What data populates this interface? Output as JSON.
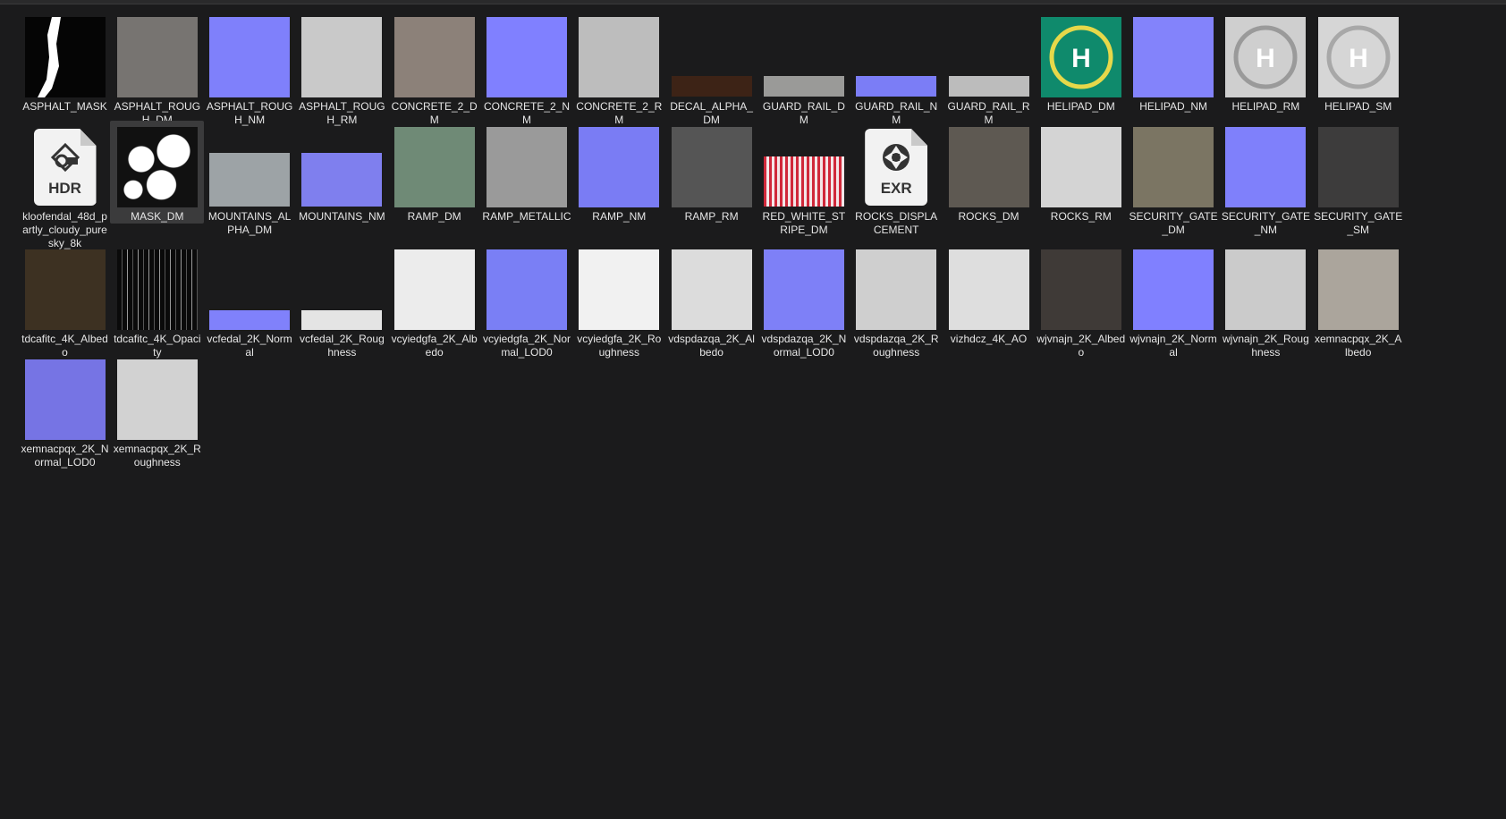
{
  "files": [
    {
      "name": "ASPHALT_MASK",
      "thumb": "mask",
      "bg": "#050505"
    },
    {
      "name": "ASPHALT_ROUGH_DM",
      "thumb": "square",
      "bg": "#777471"
    },
    {
      "name": "ASPHALT_ROUGH_NM",
      "thumb": "square",
      "bg": "#7f80fb"
    },
    {
      "name": "ASPHALT_ROUGH_RM",
      "thumb": "square",
      "bg": "#c9c9c9"
    },
    {
      "name": "CONCRETE_2_DM",
      "thumb": "square",
      "bg": "#8c8179"
    },
    {
      "name": "CONCRETE_2_NM",
      "thumb": "square",
      "bg": "#8080ff"
    },
    {
      "name": "CONCRETE_2_RM",
      "thumb": "square",
      "bg": "#bdbdbd"
    },
    {
      "name": "DECAL_ALPHA_DM",
      "thumb": "strip",
      "bg": "#3d2316"
    },
    {
      "name": "GUARD_RAIL_DM",
      "thumb": "strip",
      "bg": "#9a9a98"
    },
    {
      "name": "GUARD_RAIL_NM",
      "thumb": "strip",
      "bg": "#7b7df6"
    },
    {
      "name": "GUARD_RAIL_RM",
      "thumb": "strip",
      "bg": "#bcbcbc"
    },
    {
      "name": "HELIPAD_DM",
      "thumb": "helipad",
      "bg": "#0f8a6c",
      "ring": "#e6d84a",
      "letter": "H"
    },
    {
      "name": "HELIPAD_NM",
      "thumb": "square",
      "bg": "#8383fb"
    },
    {
      "name": "HELIPAD_RM",
      "thumb": "helipad",
      "bg": "#cfcfcf",
      "ring": "#9a9a9a",
      "letter": "H"
    },
    {
      "name": "HELIPAD_SM",
      "thumb": "helipad",
      "bg": "#d6d6d6",
      "ring": "#a8a8a8",
      "letter": "H"
    },
    {
      "name": "kloofendal_48d_partly_cloudy_puresky_8k",
      "thumb": "hdr-icon",
      "ext": "HDR"
    },
    {
      "name": "MASK_DM",
      "thumb": "mask2",
      "bg": "#111111",
      "selected": true
    },
    {
      "name": "MOUNTAINS_ALPHA_DM",
      "thumb": "half",
      "bg": "#9da3a6"
    },
    {
      "name": "MOUNTAINS_NM",
      "thumb": "half",
      "bg": "#7f7fee"
    },
    {
      "name": "RAMP_DM",
      "thumb": "square",
      "bg": "#6f8a76"
    },
    {
      "name": "RAMP_METALLIC",
      "thumb": "square",
      "bg": "#9a9a9a"
    },
    {
      "name": "RAMP_NM",
      "thumb": "square",
      "bg": "#7a7cf4"
    },
    {
      "name": "RAMP_RM",
      "thumb": "square",
      "bg": "#555555"
    },
    {
      "name": "RED_WHITE_STRIPE_DM",
      "thumb": "stripes",
      "bg": "#d0283a"
    },
    {
      "name": "ROCKS_DISPLACEMENT",
      "thumb": "exr-icon",
      "ext": "EXR"
    },
    {
      "name": "ROCKS_DM",
      "thumb": "square",
      "bg": "#5e5952"
    },
    {
      "name": "ROCKS_RM",
      "thumb": "square",
      "bg": "#d4d4d4"
    },
    {
      "name": "SECURITY_GATE_DM",
      "thumb": "square",
      "bg": "#7b7563"
    },
    {
      "name": "SECURITY_GATE_NM",
      "thumb": "square",
      "bg": "#7f80fb"
    },
    {
      "name": "SECURITY_GATE_SM",
      "thumb": "square",
      "bg": "#3d3c3c"
    },
    {
      "name": "tdcafitc_4K_Albedo",
      "thumb": "square",
      "bg": "#3d3122"
    },
    {
      "name": "tdcafitc_4K_Opacity",
      "thumb": "opacity",
      "bg": "#0a0a0a"
    },
    {
      "name": "vcfedal_2K_Normal",
      "thumb": "lowstrip",
      "bg": "#8081fb"
    },
    {
      "name": "vcfedal_2K_Roughness",
      "thumb": "lowstrip",
      "bg": "#e4e4e4"
    },
    {
      "name": "vcyiedgfa_2K_Albedo",
      "thumb": "square",
      "bg": "#ececec"
    },
    {
      "name": "vcyiedgfa_2K_Normal_LOD0",
      "thumb": "square",
      "bg": "#7a7ff5"
    },
    {
      "name": "vcyiedgfa_2K_Roughness",
      "thumb": "square",
      "bg": "#f1f1f1"
    },
    {
      "name": "vdspdazqa_2K_Albedo",
      "thumb": "square",
      "bg": "#dcdcdc"
    },
    {
      "name": "vdspdazqa_2K_Normal_LOD0",
      "thumb": "square",
      "bg": "#7e80f7"
    },
    {
      "name": "vdspdazqa_2K_Roughness",
      "thumb": "square",
      "bg": "#cfcfcf"
    },
    {
      "name": "vizhdcz_4K_AO",
      "thumb": "square",
      "bg": "#dedede"
    },
    {
      "name": "wjvnajn_2K_Albedo",
      "thumb": "square",
      "bg": "#3f3a37"
    },
    {
      "name": "wjvnajn_2K_Normal",
      "thumb": "square",
      "bg": "#8080ff"
    },
    {
      "name": "wjvnajn_2K_Roughness",
      "thumb": "square",
      "bg": "#cbcbcb"
    },
    {
      "name": "xemnacpqx_2K_Albedo",
      "thumb": "square",
      "bg": "#aba59c"
    },
    {
      "name": "xemnacpqx_2K_Normal_LOD0",
      "thumb": "square",
      "bg": "#7674e4"
    },
    {
      "name": "xemnacpqx_2K_Roughness",
      "thumb": "square",
      "bg": "#d2d2d2"
    }
  ]
}
